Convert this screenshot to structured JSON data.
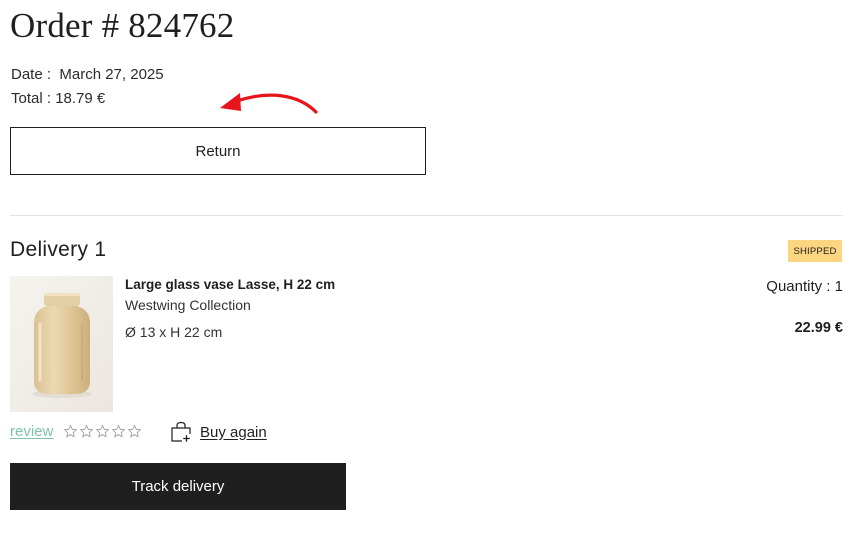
{
  "order": {
    "title": "Order # 824762",
    "date_label": "Date :",
    "date_value": "March 27, 2025",
    "total_label": "Total :",
    "total_value": "18.79 €"
  },
  "annotation": {
    "arrow_color": "#e8141c",
    "icon": "red-curved-arrow-icon"
  },
  "actions": {
    "return_label": "Return",
    "track_label": "Track delivery"
  },
  "delivery": {
    "title": "Delivery 1",
    "status": "SHIPPED",
    "status_color": "#fcd581",
    "items": [
      {
        "name": "Large glass vase Lasse, H 22 cm",
        "brand": "Westwing Collection",
        "dimensions": "Ø 13 x H 22 cm",
        "quantity_label": "Quantity : 1",
        "price": "22.99 €",
        "image_icon": "amber-glass-vase-image",
        "review_label": "review",
        "rating": 0,
        "rating_max": 5,
        "buy_again_label": "Buy again",
        "buy_again_icon": "shopping-bag-plus-icon"
      }
    ]
  },
  "colors": {
    "accent_link": "#7fc4a7",
    "button_dark": "#1f1f20"
  }
}
